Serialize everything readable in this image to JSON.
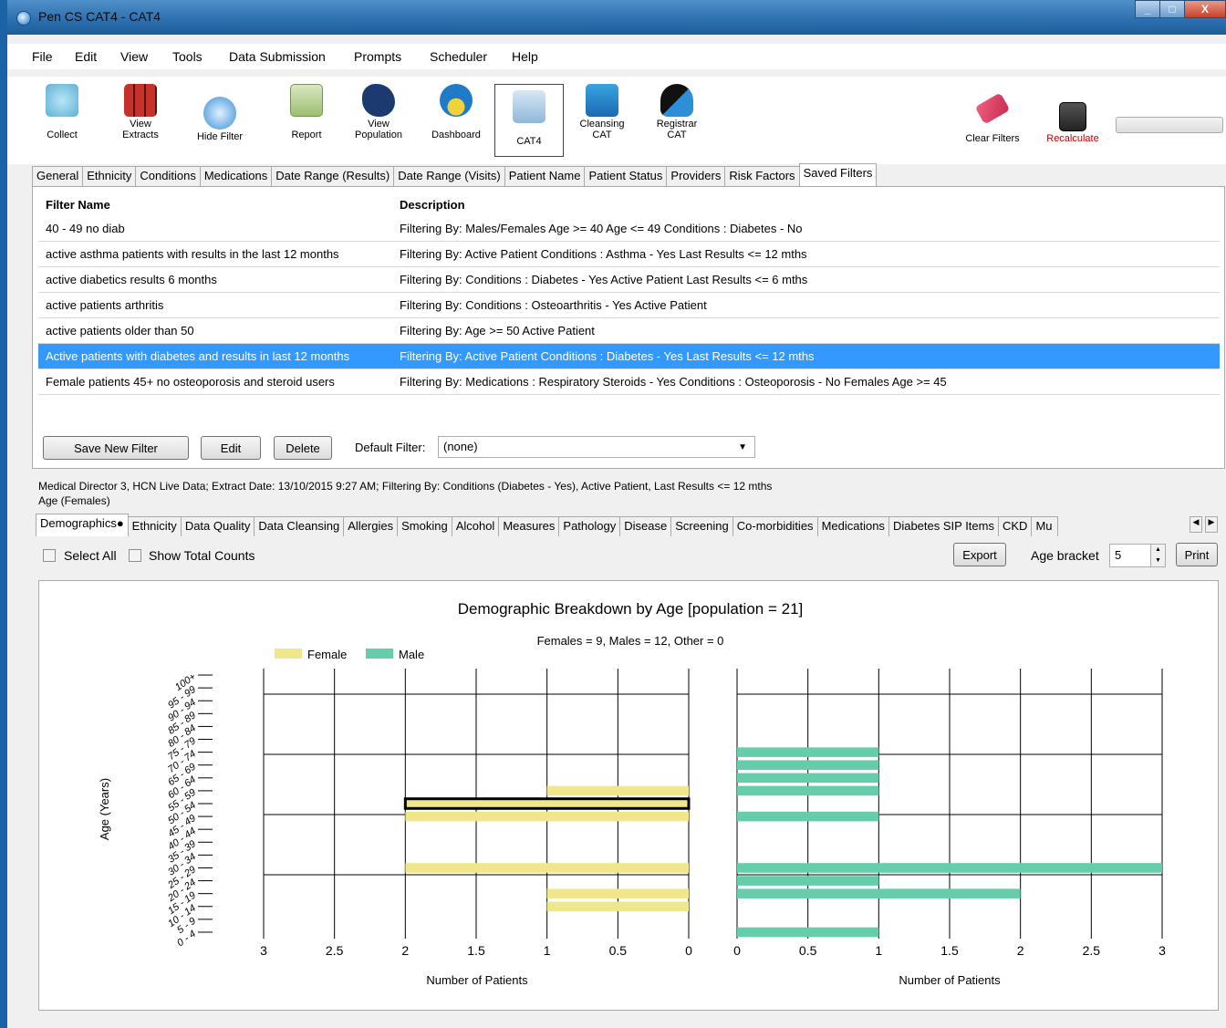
{
  "window": {
    "title": "Pen CS CAT4 - CAT4",
    "controls": [
      "_",
      "□",
      "X"
    ]
  },
  "menu": [
    "File",
    "Edit",
    "View",
    "Tools",
    "Data Submission",
    "Prompts",
    "Scheduler",
    "Help"
  ],
  "toolbar": {
    "collect": "Collect",
    "view_extracts_1": "View",
    "view_extracts_2": "Extracts",
    "hide_filter": "Hide Filter",
    "report": "Report",
    "view_population_1": "View",
    "view_population_2": "Population",
    "dashboard": "Dashboard",
    "cat4": "CAT4",
    "cleansing_1": "Cleansing",
    "cleansing_2": "CAT",
    "registrar_1": "Registrar",
    "registrar_2": "CAT",
    "clear_filters": "Clear Filters",
    "recalculate": "Recalculate",
    "recalculate_color": "#cc0000"
  },
  "filter_tabs": [
    "General",
    "Ethnicity",
    "Conditions",
    "Medications",
    "Date Range (Results)",
    "Date Range (Visits)",
    "Patient Name",
    "Patient Status",
    "Providers",
    "Risk Factors",
    "Saved Filters"
  ],
  "filters": {
    "header_name": "Filter Name",
    "header_desc": "Description",
    "rows": [
      {
        "name": "40 - 49 no diab",
        "desc": "Filtering By:  Males/Females  Age >= 40  Age <= 49  Conditions : Diabetes - No"
      },
      {
        "name": "active asthma patients with results in the last 12 months",
        "desc": "Filtering By:  Active Patient  Conditions : Asthma - Yes   Last Results <= 12 mths"
      },
      {
        "name": "active diabetics results 6 months",
        "desc": "Filtering By:  Conditions : Diabetes - Yes   Active Patient  Last Results <= 6 mths"
      },
      {
        "name": "active patients arthritis",
        "desc": "Filtering By:  Conditions : Osteoarthritis - Yes   Active Patient"
      },
      {
        "name": "active patients older than 50",
        "desc": "Filtering By:  Age >= 50  Active Patient"
      },
      {
        "name": "Active patients with diabetes and results in last 12 months",
        "desc": "Filtering By:  Active Patient  Conditions : Diabetes - Yes   Last Results <= 12 mths"
      },
      {
        "name": "Female patients 45+ no osteoporosis and steroid users",
        "desc": "Filtering By:  Medications : Respiratory Steroids - Yes   Conditions : Osteoporosis - No   Females  Age >= 45"
      }
    ],
    "selected_color": "#3399ff"
  },
  "filter_buttons": {
    "save": "Save New Filter",
    "edit": "Edit",
    "delete": "Delete",
    "default_label": "Default Filter:",
    "default_value": "(none)"
  },
  "info": {
    "line1": "Medical Director 3, HCN Live Data; Extract Date: 13/10/2015 9:27 AM; Filtering By: Conditions (Diabetes - Yes), Active Patient, Last Results <= 12 mths",
    "line2": "Age (Females)"
  },
  "report_tabs": [
    "Demographics●",
    "Ethnicity",
    "Data Quality",
    "Data Cleansing",
    "Allergies",
    "Smoking",
    "Alcohol",
    "Measures",
    "Pathology",
    "Disease",
    "Screening",
    "Co-morbidities",
    "Medications",
    "Diabetes SIP Items",
    "CKD",
    "Mu"
  ],
  "options": {
    "select_all": "Select All",
    "show_total": "Show Total Counts",
    "export": "Export",
    "age_bracket": "Age bracket",
    "age_value": "5",
    "print": "Print"
  },
  "chart_data": {
    "type": "bar",
    "title": "Demographic Breakdown by Age [population = 21]",
    "subtitle": "Females = 9, Males = 12, Other = 0",
    "ylabel": "Age (Years)",
    "xlabel": "Number of Patients",
    "categories": [
      "0 - 4",
      "5 - 9",
      "10 - 14",
      "15 - 19",
      "20 - 24",
      "25 - 29",
      "30 - 34",
      "35 - 39",
      "40 - 44",
      "45 - 49",
      "50 - 54",
      "55 - 59",
      "60 - 64",
      "65 - 69",
      "70 - 74",
      "75 - 79",
      "80 - 84",
      "85 - 89",
      "90 - 94",
      "95 - 99",
      "100+"
    ],
    "series": [
      {
        "name": "Female",
        "color": "#f0e68c",
        "values": [
          0,
          0,
          1,
          1,
          0,
          2,
          0,
          0,
          0,
          2,
          2,
          1,
          0,
          0,
          0,
          0,
          0,
          0,
          0,
          0,
          0
        ]
      },
      {
        "name": "Male",
        "color": "#66cdaa",
        "values": [
          1,
          0,
          0,
          2,
          1,
          3,
          0,
          0,
          0,
          1,
          0,
          1,
          1,
          1,
          1,
          0,
          0,
          0,
          0,
          0,
          0
        ]
      }
    ],
    "xlim": [
      0,
      3
    ],
    "xticks": [
      "3",
      "2.5",
      "2",
      "1.5",
      "1",
      "0.5",
      "0"
    ],
    "xticks_right": [
      "0",
      "0.5",
      "1",
      "1.5",
      "2",
      "2.5",
      "3"
    ],
    "highlighted_category": "50 - 54",
    "legend": "top-left",
    "grid": true
  }
}
